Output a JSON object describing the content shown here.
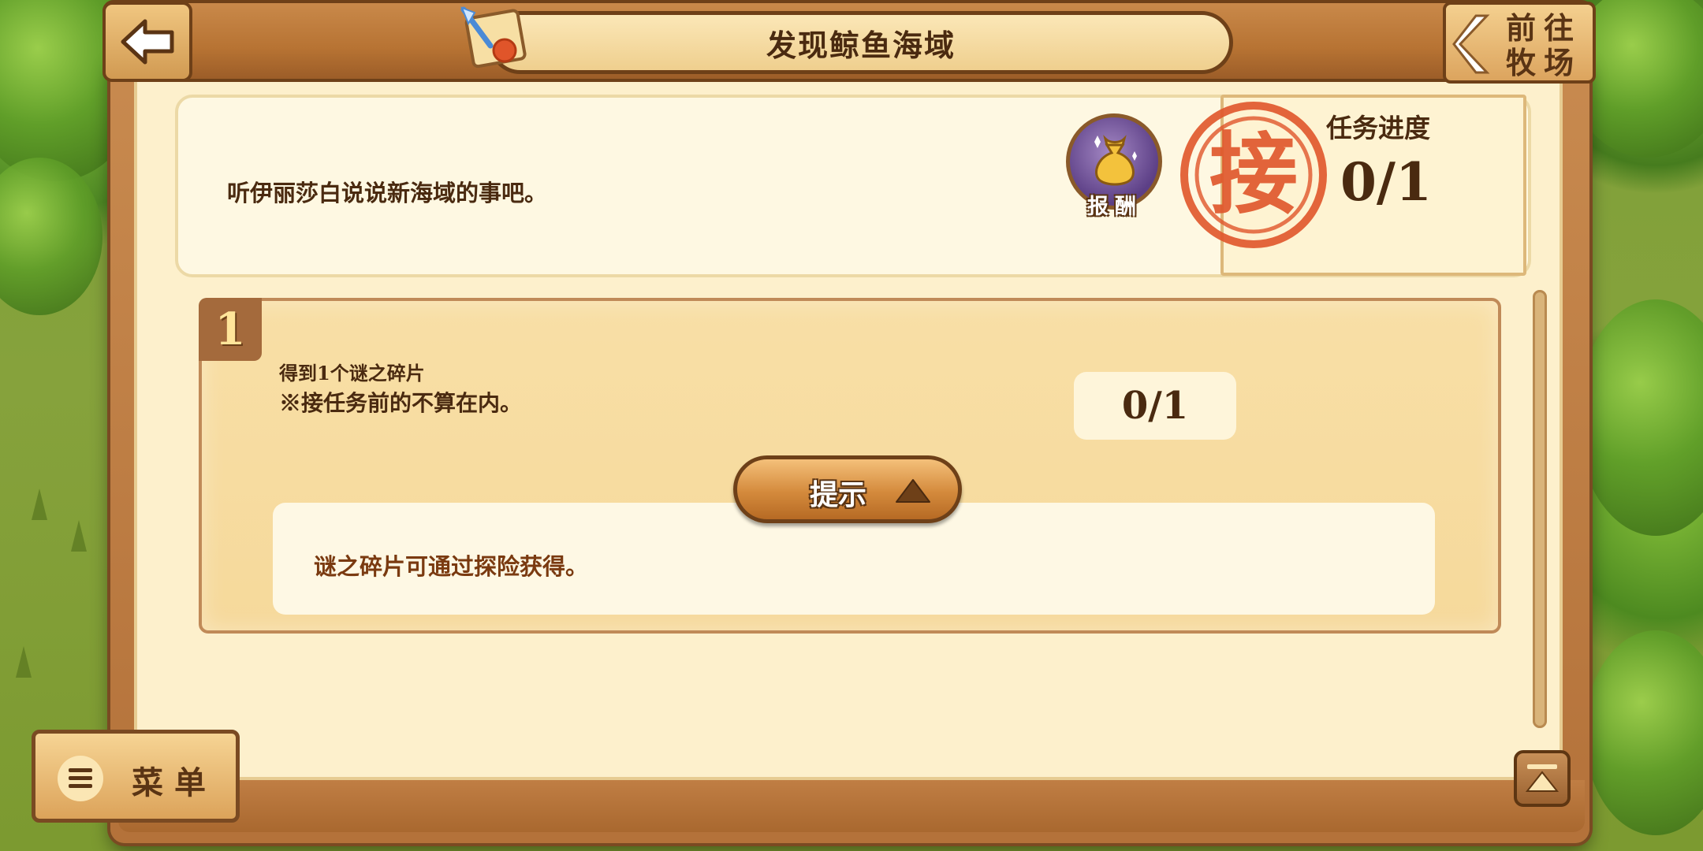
{
  "header": {
    "title": "发现鲸鱼海域",
    "back_icon": "back-arrow-icon",
    "goto_label": "前往牧场"
  },
  "quest": {
    "description": "听伊丽莎白说说新海域的事吧。",
    "reward_label": "报酬",
    "stamp_char": "接",
    "progress_label": "任务进度",
    "progress_value": "0/1"
  },
  "tasks": [
    {
      "number": "1",
      "line1": "得到1个谜之碎片",
      "line2": "※接任务前的不算在内。",
      "count": "0/1",
      "hint_button": "提示",
      "hint_text": "谜之碎片可通过探险获得。"
    }
  ],
  "menu": {
    "label": "菜单"
  },
  "colors": {
    "wood": "#b77333",
    "parchment": "#fdf0cc",
    "text": "#4a2a10",
    "stamp": "#e0552a"
  }
}
